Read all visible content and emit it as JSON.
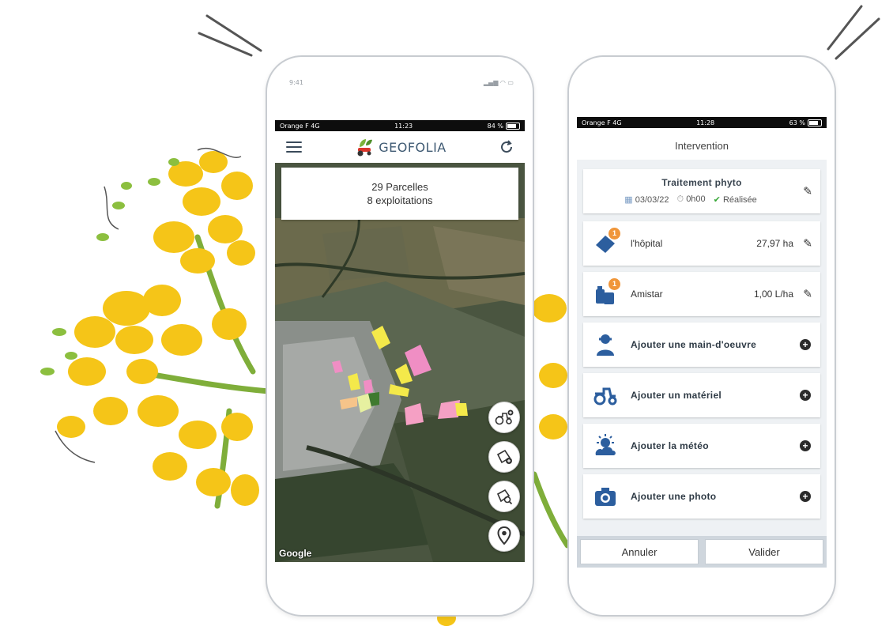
{
  "phone1": {
    "top_time": "9:41",
    "status": {
      "carrier": "Orange F  4G",
      "time": "11:23",
      "battery": "84 %"
    },
    "app_title": "GEOFOLIA",
    "map": {
      "parcels_count": "29 Parcelles",
      "farms_count": "8 exploitations",
      "attribution": "Google"
    },
    "icons": [
      "menu-icon",
      "refresh-icon",
      "tractor-add-icon",
      "parcel-add-icon",
      "parcel-search-icon",
      "location-pin-icon"
    ]
  },
  "phone2": {
    "status": {
      "carrier": "Orange F  4G",
      "time": "11:28",
      "battery": "63 %"
    },
    "title": "Intervention",
    "treatment": {
      "name": "Traitement phyto",
      "date": "03/03/22",
      "duration": "0h00",
      "status": "Réalisée"
    },
    "items": [
      {
        "label": "l'hôpital",
        "value": "27,97 ha",
        "badge": "1"
      },
      {
        "label": "Amistar",
        "value": "1,00 L/ha",
        "badge": "1"
      }
    ],
    "actions": [
      {
        "label": "Ajouter une main-d'oeuvre"
      },
      {
        "label": "Ajouter un matériel"
      },
      {
        "label": "Ajouter la météo"
      },
      {
        "label": "Ajouter une photo"
      }
    ],
    "buttons": {
      "cancel": "Annuler",
      "validate": "Valider"
    }
  },
  "colors": {
    "accent": "#3f6fa6",
    "badge": "#f0963a",
    "flower": "#f5c518",
    "check": "#3aa83a"
  }
}
